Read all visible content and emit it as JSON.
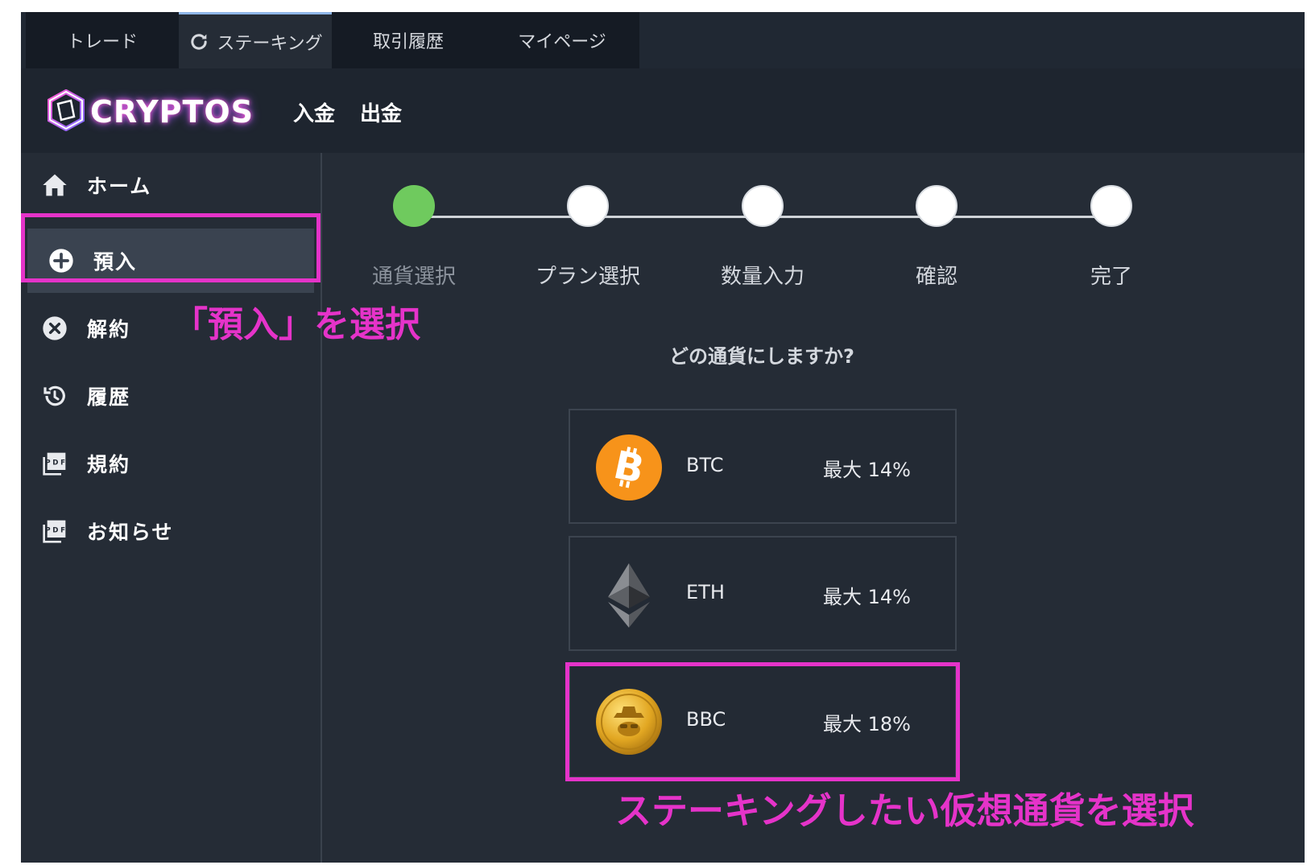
{
  "tabs": [
    {
      "label": "トレード"
    },
    {
      "label": "ステーキング",
      "active": true,
      "icon": "refresh-icon"
    },
    {
      "label": "取引履歴"
    },
    {
      "label": "マイページ"
    }
  ],
  "header": {
    "logo_text": "CRYPTOS",
    "links": [
      "入金",
      "出金"
    ]
  },
  "sidebar": {
    "items": [
      {
        "label": "ホーム",
        "icon": "home-icon"
      },
      {
        "label": "預入",
        "icon": "plus-circle-icon",
        "active": true
      },
      {
        "label": "解約",
        "icon": "close-circle-icon"
      },
      {
        "label": "履歴",
        "icon": "history-icon"
      },
      {
        "label": "規約",
        "icon": "pdf-icon"
      },
      {
        "label": "お知らせ",
        "icon": "pdf-icon"
      }
    ]
  },
  "steps": [
    "通貨選択",
    "プラン選択",
    "数量入力",
    "確認",
    "完了"
  ],
  "question": "どの通貨にしますか?",
  "coins": [
    {
      "name": "BTC",
      "rate": "最大 14%",
      "icon": "bitcoin-icon"
    },
    {
      "name": "ETH",
      "rate": "最大 14%",
      "icon": "ethereum-icon"
    },
    {
      "name": "BBC",
      "rate": "最大 18%",
      "icon": "bbc-coin-icon"
    }
  ],
  "annotations": {
    "deposit": "「預入」を選択",
    "coin": "ステーキングしたい仮想通貨を選択"
  },
  "colors": {
    "highlight": "#e533c9",
    "step_done": "#6fca5e",
    "btc": "#f7931a"
  }
}
